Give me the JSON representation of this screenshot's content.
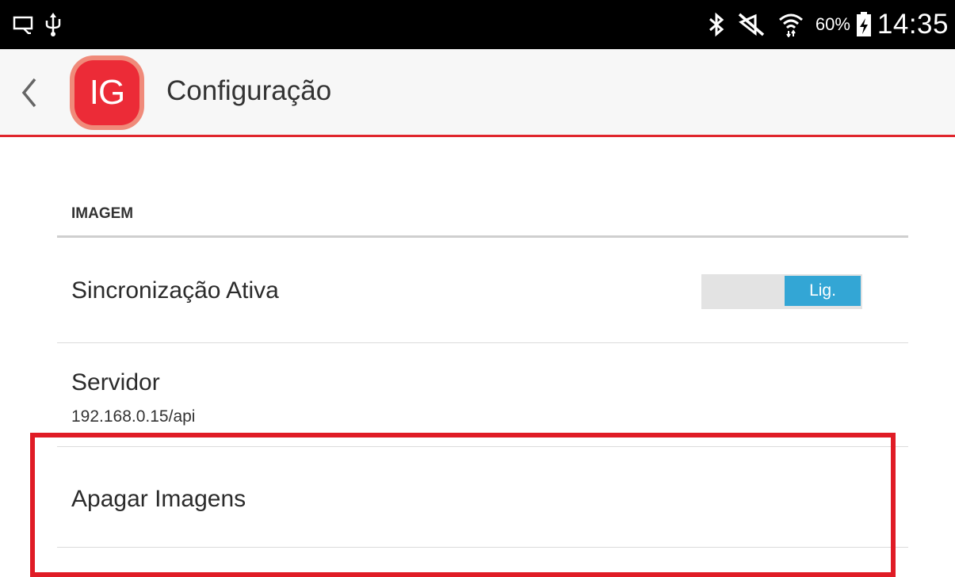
{
  "status_bar": {
    "icons_left": [
      "screen-cast-icon",
      "usb-icon"
    ],
    "icons_right": [
      "bluetooth-icon",
      "mute-icon",
      "wifi-icon",
      "battery-charging-icon"
    ],
    "battery": "60%",
    "time": "14:35"
  },
  "action_bar": {
    "logo_text": "IG",
    "title": "Configuração",
    "accent_color": "#e0252c"
  },
  "settings": {
    "section_header": "IMAGEM",
    "items": [
      {
        "title": "Sincronização Ativa",
        "switch_label": "Lig.",
        "switch_on": true
      },
      {
        "title": "Servidor",
        "summary": "192.168.0.15/api"
      },
      {
        "title": "Apagar Imagens"
      }
    ],
    "switch_color": "#33a6d5",
    "highlight_color": "#e01c26"
  }
}
